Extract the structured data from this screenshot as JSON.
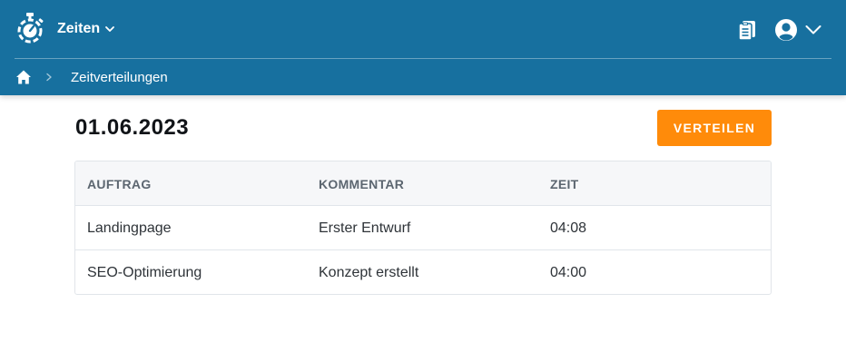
{
  "app": {
    "menu_title": "Zeiten",
    "colors": {
      "header": "#17709f",
      "accent": "#ff8b0a"
    }
  },
  "icons": {
    "logo": "stopwatch-logo-icon",
    "menu": "chevron-down-icon",
    "clipboard": "clipboard-icon",
    "user": "user-circle-icon",
    "home": "home-icon",
    "separator": "chevron-right-icon"
  },
  "breadcrumb": {
    "items": [
      "Zeitverteilungen"
    ]
  },
  "main": {
    "date": "01.06.2023",
    "action_label": "VERTEILEN"
  },
  "table": {
    "headers": [
      "AUFTRAG",
      "KOMMENTAR",
      "ZEIT"
    ],
    "rows": [
      [
        "Landingpage",
        "Erster Entwurf",
        "04:08"
      ],
      [
        "SEO-Optimierung",
        "Konzept erstellt",
        "04:00"
      ]
    ]
  }
}
